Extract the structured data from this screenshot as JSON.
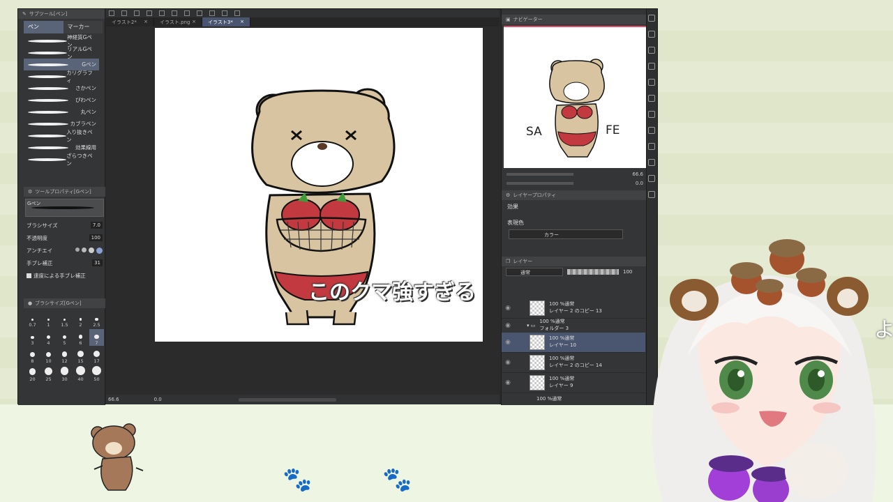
{
  "subtool": {
    "header": "サブツール[ペン]",
    "tab_pen": "ペン",
    "tab_marker": "マーカー",
    "brushes": [
      {
        "label": "神経質Gペン"
      },
      {
        "label": "リアルGペン"
      },
      {
        "label": "Gペン"
      },
      {
        "label": "カリグラフィ"
      },
      {
        "label": "さかペン"
      },
      {
        "label": "ぴわペン"
      },
      {
        "label": "丸ペン"
      },
      {
        "label": "カブラペン"
      },
      {
        "label": "入り抜きペン"
      },
      {
        "label": "効果線用"
      },
      {
        "label": "ざらつきペン"
      }
    ],
    "selected_index": 2
  },
  "tool_property": {
    "header": "ツールプロパティ[Gペン]",
    "brush_name": "Gペン",
    "brush_size_label": "ブラシサイズ",
    "brush_size_value": "7.0",
    "opacity_label": "不透明度",
    "opacity_value": "100",
    "antialias_label": "アンチエイ",
    "stabilization_label": "手ブレ補正",
    "stabilization_value": "31",
    "speed_stabilization_label": "速度による手ブレ補正"
  },
  "brush_size_panel": {
    "header": "ブラシサイズ[Gペン]",
    "sizes": [
      "0.7",
      "1",
      "1.5",
      "2",
      "2.5",
      "3",
      "4",
      "5",
      "6",
      "7",
      "8",
      "10",
      "12",
      "15",
      "17",
      "20",
      "25",
      "30",
      "40",
      "50"
    ],
    "selected": "7"
  },
  "doc_tabs": [
    {
      "label": "イラスト2*",
      "active": false
    },
    {
      "label": "イラスト.png",
      "active": false
    },
    {
      "label": "イラスト3*",
      "active": true
    }
  ],
  "canvas": {
    "caption": "このクマ強すぎる",
    "zoom": "66.6",
    "angle": "0.0"
  },
  "navigator": {
    "header": "ナビゲーター",
    "text_left": "SA",
    "text_right": "FE",
    "zoom": "66.6",
    "angle": "0.0"
  },
  "layer_property": {
    "header": "レイヤープロパティ",
    "effect_label": "効果",
    "expression_label": "表現色",
    "expression_value": "カラー"
  },
  "layers": {
    "header": "レイヤー",
    "blend_mode": "通常",
    "opacity": "100",
    "items": [
      {
        "type": "layer",
        "mode": "100 %通常",
        "name": "レイヤー 2 のコピー 13",
        "selected": false
      },
      {
        "type": "folder",
        "mode": "100 %通常",
        "name": "フォルダー 3",
        "selected": false
      },
      {
        "type": "layer",
        "mode": "100 %通常",
        "name": "レイヤー 10",
        "selected": true
      },
      {
        "type": "layer",
        "mode": "100 %通常",
        "name": "レイヤー 2 のコピー 14",
        "selected": false
      },
      {
        "type": "layer",
        "mode": "100 %通常",
        "name": "レイヤー 9",
        "selected": false
      }
    ],
    "trailing_mode": "100 %通常"
  },
  "overlay": {
    "edge_char": "よ"
  },
  "colors": {
    "accent": "#5a6478",
    "bear_fur": "#d8c4a0",
    "bikini": "#c23a3f",
    "nav_top_line": "#e0506a"
  }
}
